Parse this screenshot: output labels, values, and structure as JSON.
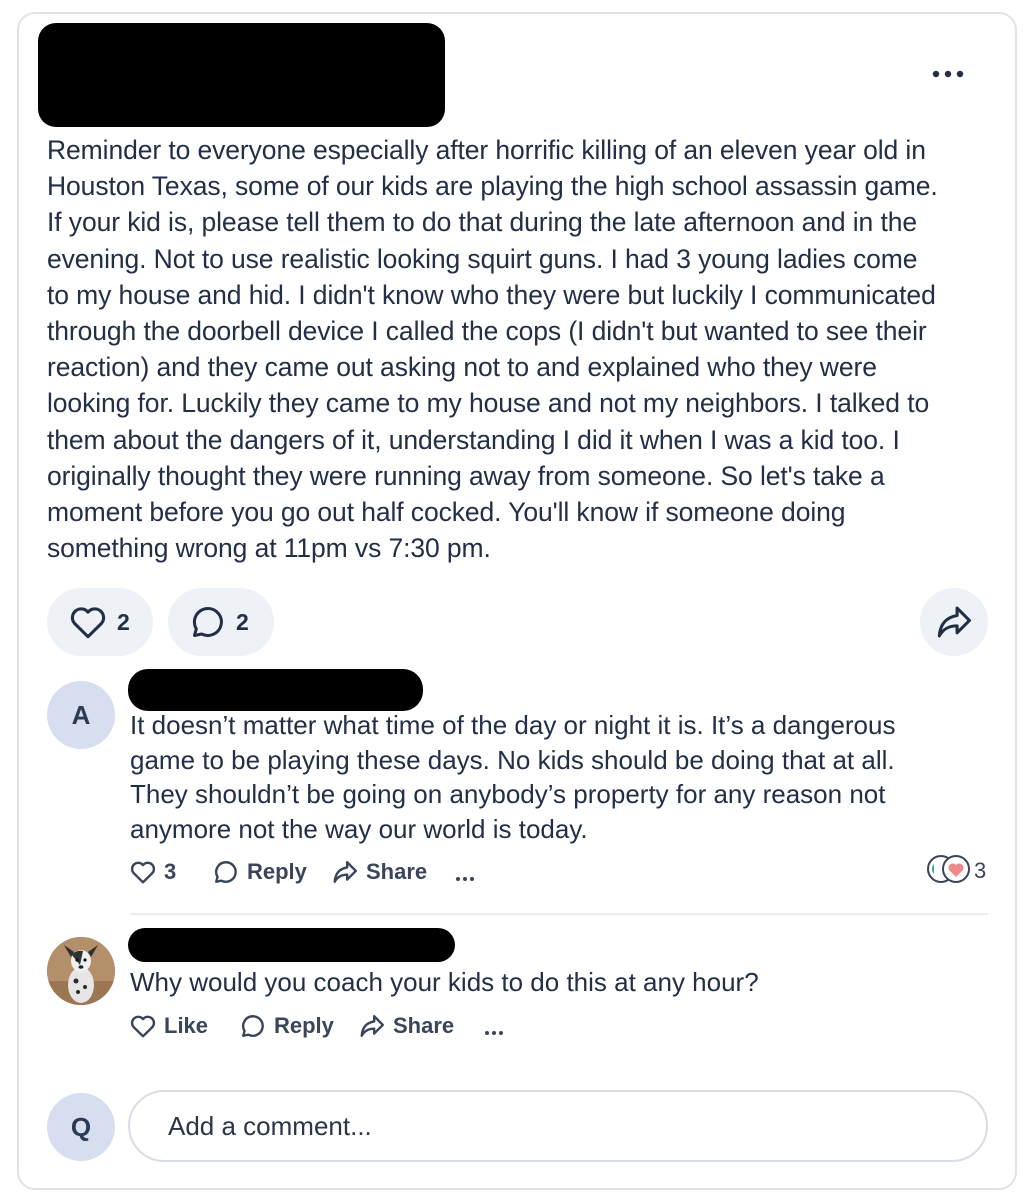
{
  "post": {
    "body_lines": [
      "Reminder to everyone especially after horrific killing of an eleven year old in",
      "Houston Texas, some of our kids are playing the high school assassin game.",
      "If your kid is, please tell them to do that during the late afternoon and in the",
      "evening.  Not to use realistic looking squirt guns. I had 3 young ladies come",
      "to my house and hid. I didn't know who they were but luckily I communicated",
      "through the doorbell device I called the cops (I didn't but wanted to see their",
      "reaction) and they came out asking not to and explained who they were",
      "looking for. Luckily they came to my house and not my neighbors.  I talked to",
      "them about the dangers of it, understanding I did it when I was a kid too. I",
      "originally thought they were running away from someone. So let's take a",
      "moment before you go out half cocked.  You'll know if someone doing",
      "something wrong at 11pm vs 7:30 pm."
    ],
    "like_count": "2",
    "comment_count": "2"
  },
  "comments": [
    {
      "avatar_letter": "A",
      "text_lines": [
        "It doesn’t matter what time of the day or night it is. It’s a dangerous",
        "game to be playing these days. No kids should be doing that at all.",
        "They shouldn’t be going on anybody’s property for any reason not",
        "anymore not the way our world is today."
      ],
      "like_label": "3",
      "reply_label": "Reply",
      "share_label": "Share",
      "reaction_count": "3"
    },
    {
      "text_lines": [
        "Why would you coach your kids to do this at any hour?"
      ],
      "like_label": "Like",
      "reply_label": "Reply",
      "share_label": "Share"
    }
  ],
  "composer": {
    "avatar_letter": "Q",
    "placeholder": "Add a comment..."
  },
  "colors": {
    "text": "#232f46",
    "pill_bg": "#eef1f5",
    "avatar_bg": "#d7def0",
    "reaction_heart": "#f08a8a",
    "reaction_green": "#3fb27f"
  },
  "icons": [
    "more-icon",
    "heart-icon",
    "comment-icon",
    "share-arrow-icon",
    "reaction-heart-icon"
  ]
}
